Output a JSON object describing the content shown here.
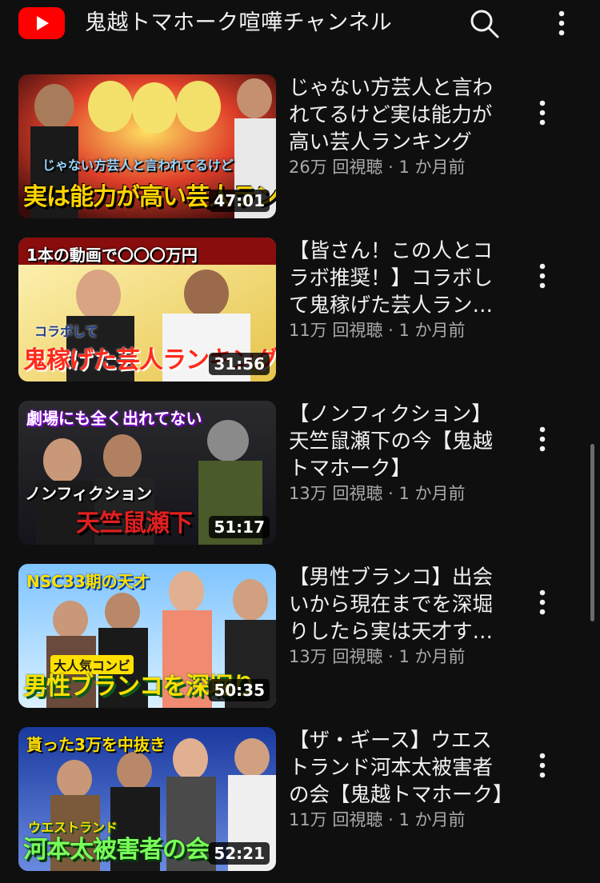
{
  "header": {
    "channel_title": "鬼越トマホーク喧嘩チャンネル",
    "logo_icon": "youtube-logo-icon",
    "search_icon": "search-icon",
    "more_icon": "more-vert-icon",
    "brand_color": "#ff0000"
  },
  "videos": [
    {
      "title": "じゃない方芸人と言われてるけど実は能力が高い芸人ランキング",
      "views": "26万 回視聴",
      "age": "1 か月前",
      "duration": "47:01",
      "thumb_top_text": "",
      "thumb_bottom_text": "実は能力が高い芸人ランキング",
      "thumb_mid_text": "じゃない方芸人と言われてるけど"
    },
    {
      "title": "【皆さん！この人とコラボ推奨！】コラボして鬼稼げた芸人ランキング",
      "views": "11万 回視聴",
      "age": "1 か月前",
      "duration": "31:56",
      "thumb_top_text": "1本の動画で〇〇〇万円",
      "thumb_bottom_text": "鬼稼げた芸人ランキング",
      "thumb_mid_text": "コラボして"
    },
    {
      "title": "【ノンフィクション】天竺鼠瀬下の今【鬼越トマホーク】",
      "views": "13万 回視聴",
      "age": "1 か月前",
      "duration": "51:17",
      "thumb_top_text": "劇場にも全く出れてない",
      "thumb_bottom_text": "天竺鼠瀬下",
      "thumb_mid_text": "ノンフィクション"
    },
    {
      "title": "【男性ブランコ】出会いから現在までを深堀りしたら実は天才すぎた",
      "views": "13万 回視聴",
      "age": "1 か月前",
      "duration": "50:35",
      "thumb_top_text": "NSC33期の天才",
      "thumb_bottom_text": "男性ブランコを深堀り",
      "thumb_mid_text": "大人気コンビ"
    },
    {
      "title": "【ザ・ギース】ウエストランド河本太被害者の会【鬼越トマホーク】",
      "views": "11万 回視聴",
      "age": "1 か月前",
      "duration": "52:21",
      "thumb_top_text": "貰った3万を中抜き",
      "thumb_bottom_text": "河本太被害者の会",
      "thumb_mid_text": "ウエストランド"
    }
  ],
  "stats_separator": " · ",
  "item_more_icon": "more-vert-icon"
}
